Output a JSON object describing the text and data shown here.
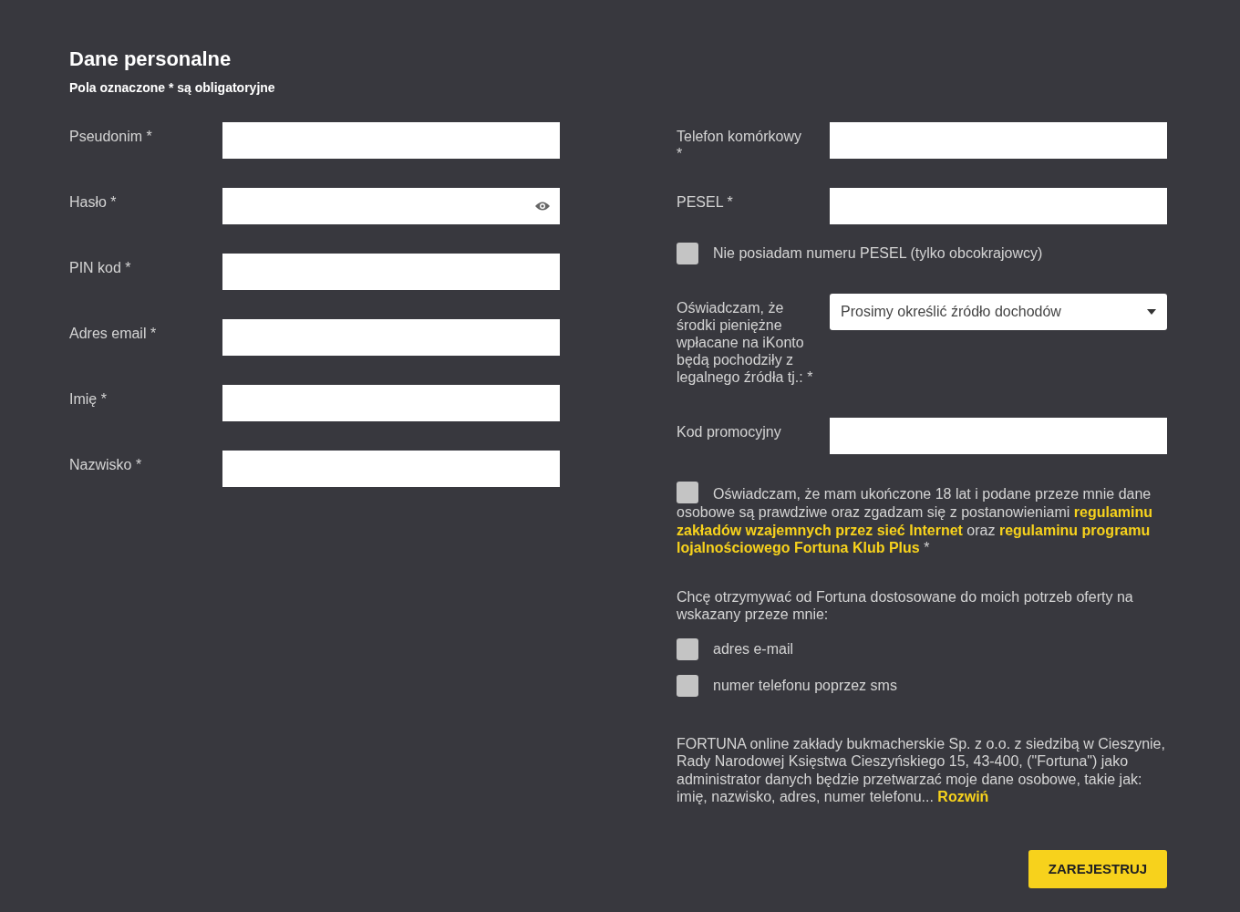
{
  "header": {
    "title": "Dane personalne",
    "subtitle": "Pola oznaczone * są obligatoryjne"
  },
  "left_fields": [
    {
      "label": "Pseudonim *",
      "kind": "text"
    },
    {
      "label": "Hasło *",
      "kind": "password"
    },
    {
      "label": "PIN kod *",
      "kind": "text"
    },
    {
      "label": "Adres email *",
      "kind": "text"
    },
    {
      "label": "Imię *",
      "kind": "text"
    },
    {
      "label": "Nazwisko *",
      "kind": "text"
    }
  ],
  "right_items": [
    {
      "kind": "field",
      "label": "Telefon komórkowy *"
    },
    {
      "kind": "field",
      "label": "PESEL *"
    },
    {
      "kind": "checkbox",
      "label": "Nie posiadam numeru PESEL (tylko obcokrajowcy)",
      "checked": false
    },
    {
      "kind": "select",
      "label": "Oświadczam, że środki pieniężne wpłacane na iKonto będą pochodziły z legalnego źródła tj.: *",
      "value": "Prosimy określić źródło dochodów"
    },
    {
      "kind": "field",
      "label": "Kod promocyjny"
    }
  ],
  "consent": {
    "checked": false,
    "segments": [
      {
        "kind": "text",
        "text": "Oświadczam, że mam ukończone 18 lat i podane przeze mnie dane osobowe są prawdziwe oraz zgadzam się z postanowieniami "
      },
      {
        "kind": "link",
        "text": "regulaminu zakładów wzajemnych przez sieć Internet"
      },
      {
        "kind": "text",
        "text": " oraz "
      },
      {
        "kind": "link",
        "text": "regulaminu programu lojalnościowego Fortuna Klub Plus"
      },
      {
        "kind": "text",
        "text": " *"
      }
    ]
  },
  "offers": {
    "intro": "Chcę otrzymywać od Fortuna dostosowane do moich potrzeb oferty na wskazany przeze mnie:",
    "options": [
      {
        "label": "adres e-mail",
        "checked": false
      },
      {
        "label": "numer telefonu poprzez sms",
        "checked": false
      }
    ]
  },
  "privacy": {
    "text": "FORTUNA online zakłady bukmacherskie Sp. z o.o. z siedzibą w Cieszynie, Rady Narodowej Księstwa Cieszyńskiego 15, 43-400, (\"Fortuna\") jako administrator danych będzie przetwarzać moje dane osobowe, takie jak: imię, nazwisko, adres, numer telefonu...",
    "link": "Rozwiń"
  },
  "submit": "ZAREJESTRUJ"
}
